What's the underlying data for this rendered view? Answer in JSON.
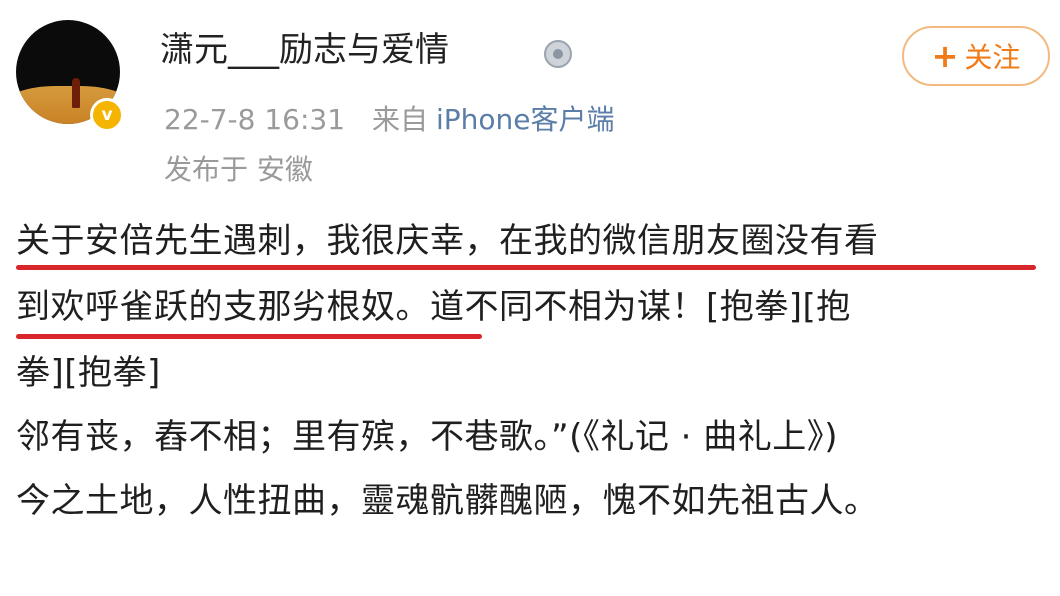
{
  "user": {
    "name": "潇元___励志与爱情",
    "avatar_icon": "avatar-image",
    "verified_badge": "v",
    "medal_icon": "medal-icon"
  },
  "follow_button": {
    "plus": "+",
    "label": "关注"
  },
  "meta": {
    "timestamp": "22-7-8 16:31",
    "from_label": "来自",
    "source": "iPhone客户端",
    "location": "发布于 安徽"
  },
  "post": {
    "lines": [
      "关于安倍先生遇刺，我很庆幸，在我的微信朋友圈没有看",
      "到欢呼雀跃的支那劣根奴。道不同不相为谋！[抱拳][抱",
      "拳][抱拳]",
      "邻有丧，舂不相；里有殡，不巷歌。”(《礼记 · 曲礼上》)",
      "今之土地，人性扭曲，靈魂骯髒醜陋，愧不如先祖古人。"
    ]
  },
  "colors": {
    "underline": "#d9262b",
    "follow": "#f07b19",
    "source_link": "#5b7ea8",
    "meta_text": "#9a9a9a"
  }
}
